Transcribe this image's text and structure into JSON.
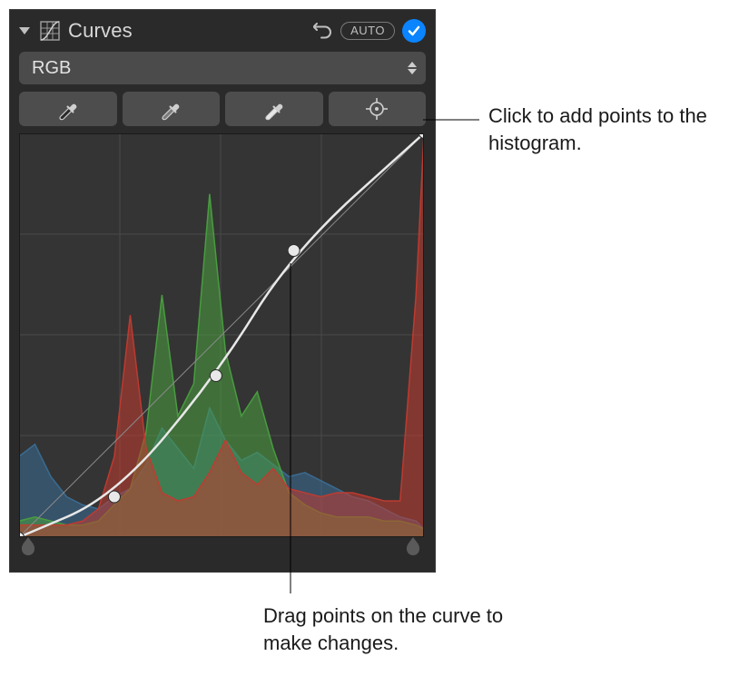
{
  "header": {
    "title": "Curves",
    "auto_label": "AUTO"
  },
  "channel_select": {
    "value": "RGB"
  },
  "tools": {
    "t1_name": "black-point-eyedropper",
    "t2_name": "gray-point-eyedropper",
    "t3_name": "white-point-eyedropper",
    "t4_name": "add-point-target"
  },
  "icons": {
    "panel_icon": "curves-grid-icon",
    "undo": "undo-icon",
    "check": "checkmark-icon",
    "stepper_up": "chevron-up-icon",
    "stepper_down": "chevron-down-icon",
    "eyedropper": "eyedropper-icon",
    "target": "crosshair-target-icon"
  },
  "slider": {
    "handle_left": "black-point-handle",
    "handle_right": "white-point-handle"
  },
  "callouts": {
    "add_point": "Click to add points to the histogram.",
    "drag_point": "Drag points on the curve to make changes."
  },
  "chart_data": {
    "type": "area",
    "title": "",
    "xlabel": "",
    "ylabel": "",
    "xlim": [
      0,
      255
    ],
    "ylim": [
      0,
      1
    ],
    "gridlines": {
      "vertical": 4,
      "horizontal": 4
    },
    "series": [
      {
        "name": "Blue",
        "color": "#3a6e95",
        "x": [
          0,
          10,
          20,
          30,
          40,
          50,
          60,
          70,
          80,
          90,
          100,
          110,
          120,
          130,
          140,
          150,
          160,
          170,
          180,
          190,
          200,
          210,
          220,
          230,
          240,
          250,
          255
        ],
        "values": [
          0.2,
          0.23,
          0.15,
          0.1,
          0.08,
          0.07,
          0.1,
          0.12,
          0.18,
          0.27,
          0.22,
          0.17,
          0.32,
          0.24,
          0.19,
          0.21,
          0.18,
          0.15,
          0.16,
          0.14,
          0.12,
          0.1,
          0.09,
          0.07,
          0.05,
          0.04,
          0.02
        ]
      },
      {
        "name": "Green",
        "color": "#4aa040",
        "x": [
          0,
          10,
          20,
          30,
          40,
          50,
          60,
          70,
          80,
          90,
          100,
          110,
          120,
          130,
          140,
          150,
          160,
          170,
          180,
          190,
          200,
          210,
          220,
          230,
          240,
          250,
          255
        ],
        "values": [
          0.04,
          0.05,
          0.04,
          0.03,
          0.03,
          0.04,
          0.08,
          0.12,
          0.26,
          0.6,
          0.3,
          0.38,
          0.85,
          0.46,
          0.3,
          0.36,
          0.22,
          0.11,
          0.08,
          0.06,
          0.05,
          0.05,
          0.05,
          0.04,
          0.04,
          0.03,
          0.02
        ]
      },
      {
        "name": "Red",
        "color": "#c23b30",
        "x": [
          0,
          10,
          20,
          30,
          40,
          50,
          60,
          70,
          80,
          90,
          100,
          110,
          120,
          130,
          140,
          150,
          160,
          170,
          180,
          190,
          200,
          210,
          220,
          230,
          240,
          250,
          255
        ],
        "values": [
          0.03,
          0.03,
          0.03,
          0.03,
          0.04,
          0.07,
          0.2,
          0.55,
          0.22,
          0.11,
          0.09,
          0.1,
          0.16,
          0.24,
          0.16,
          0.13,
          0.17,
          0.12,
          0.11,
          0.1,
          0.11,
          0.11,
          0.1,
          0.09,
          0.09,
          0.6,
          1.0
        ]
      }
    ],
    "curve": {
      "points": [
        {
          "x": 0,
          "y": 0.0
        },
        {
          "x": 60,
          "y": 0.1
        },
        {
          "x": 124,
          "y": 0.4
        },
        {
          "x": 173,
          "y": 0.71
        },
        {
          "x": 255,
          "y": 1.0
        }
      ],
      "reference_diagonal": true
    }
  }
}
